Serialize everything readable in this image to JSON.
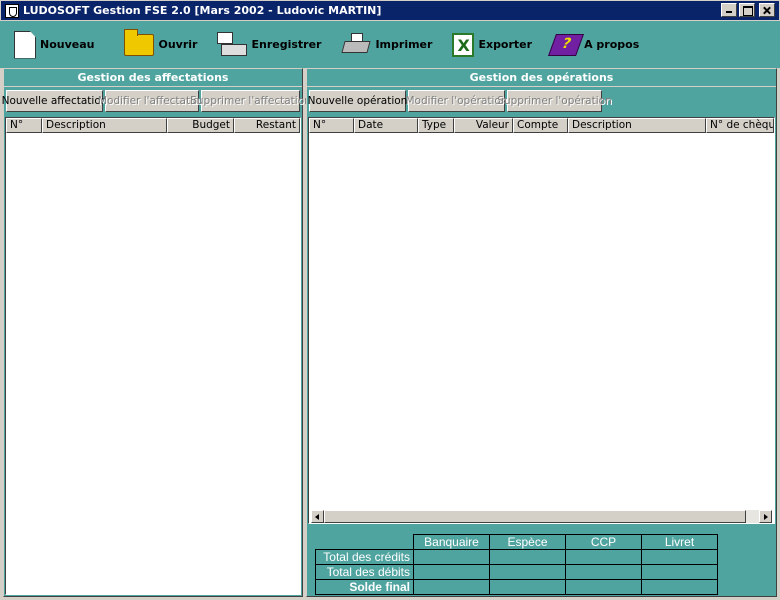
{
  "window": {
    "title": "LUDOSOFT Gestion FSE 2.0 [Mars 2002 - Ludovic MARTIN]"
  },
  "toolbar": {
    "items": [
      {
        "label": "Nouveau",
        "icon": "new-document-icon"
      },
      {
        "label": "Ouvrir",
        "icon": "folder-icon"
      },
      {
        "label": "Enregistrer",
        "icon": "save-computer-icon"
      },
      {
        "label": "Imprimer",
        "icon": "printer-icon"
      },
      {
        "label": "Exporter",
        "icon": "excel-icon"
      },
      {
        "label": "A propos",
        "icon": "help-book-icon"
      }
    ]
  },
  "affectations": {
    "header": "Gestion des affectations",
    "buttons": {
      "new": "Nouvelle affectation",
      "edit": "Modifier l'affectation",
      "delete": "Supprimer l'affectation"
    },
    "columns": [
      "N°",
      "Description",
      "Budget",
      "Restant"
    ]
  },
  "operations": {
    "header": "Gestion des opérations",
    "buttons": {
      "new": "Nouvelle opération",
      "edit": "Modifier l'opération",
      "delete": "Supprimer l'opération"
    },
    "columns": [
      "N°",
      "Date",
      "Type",
      "Valeur",
      "Compte",
      "Description",
      "N° de chèque"
    ]
  },
  "totals": {
    "columns": [
      "Banquaire",
      "Espèce",
      "CCP",
      "Livret"
    ],
    "rows": [
      "Total des crédits",
      "Total des débits",
      "Solde final"
    ]
  },
  "colors": {
    "accent": "#50a4a0",
    "titlebar": "#0a246a",
    "face": "#d4d0c8"
  }
}
